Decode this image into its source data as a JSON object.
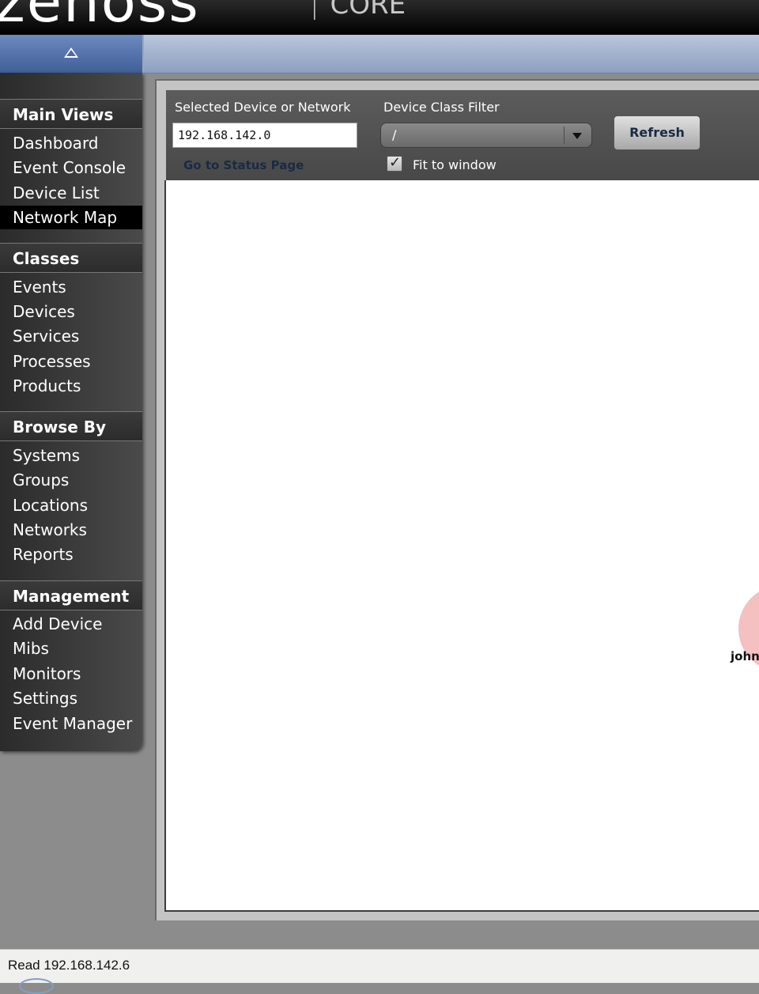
{
  "app": {
    "logo_text": "zenoss",
    "product": "CORE",
    "separator": "|"
  },
  "sidebar": {
    "collapse_icon": "triangle-up-icon",
    "sections": [
      {
        "title": "Main Views",
        "items": [
          "Dashboard",
          "Event Console",
          "Device List",
          "Network Map"
        ]
      },
      {
        "title": "Classes",
        "items": [
          "Events",
          "Devices",
          "Services",
          "Processes",
          "Products"
        ]
      },
      {
        "title": "Browse By",
        "items": [
          "Systems",
          "Groups",
          "Locations",
          "Networks",
          "Reports"
        ]
      },
      {
        "title": "Management",
        "items": [
          "Add Device",
          "Mibs",
          "Monitors",
          "Settings",
          "Event Manager"
        ]
      }
    ],
    "active_item": "Network Map"
  },
  "toolbar": {
    "selected_label": "Selected Device or Network",
    "selected_value": "192.168.142.0",
    "status_link": "Go to Status Page",
    "filter_label": "Device Class Filter",
    "filter_value": "/",
    "fit_label": "Fit to window",
    "fit_checked": true,
    "refresh_label": "Refresh"
  },
  "map": {
    "node_label": "john",
    "node_color": "#f5c0c0"
  },
  "statusbar": {
    "text": "Read 192.168.142.6"
  }
}
